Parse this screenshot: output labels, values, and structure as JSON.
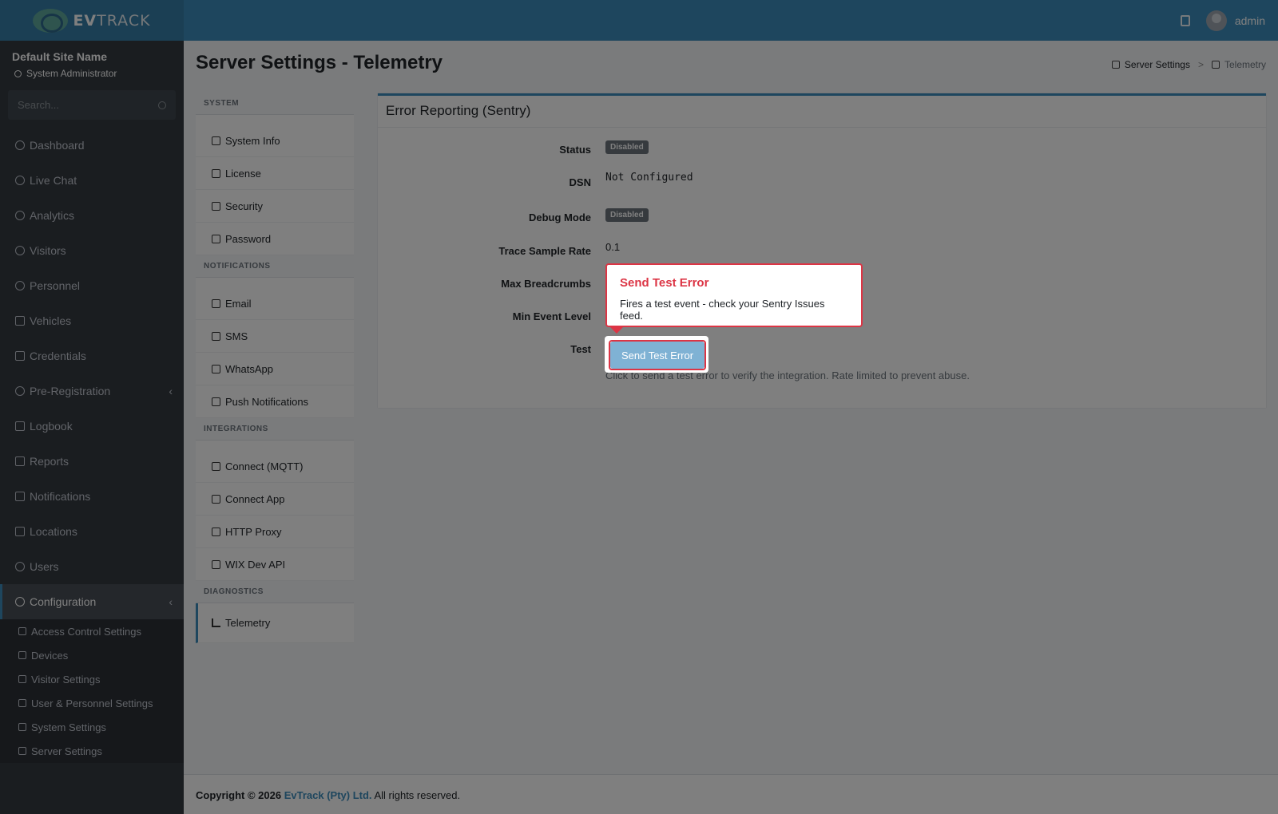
{
  "brand": {
    "name_bold": "EV",
    "name_light": "TRACK"
  },
  "topbar": {
    "user": "admin"
  },
  "sidebar": {
    "site_name": "Default Site Name",
    "role": "System Administrator",
    "search_placeholder": "Search...",
    "items": [
      {
        "label": "Dashboard",
        "icon": "gauge-icon"
      },
      {
        "label": "Live Chat",
        "icon": "headset-icon"
      },
      {
        "label": "Analytics",
        "icon": "target-icon"
      },
      {
        "label": "Visitors",
        "icon": "eye-icon"
      },
      {
        "label": "Personnel",
        "icon": "user-gear-icon"
      },
      {
        "label": "Vehicles",
        "icon": "car-icon"
      },
      {
        "label": "Credentials",
        "icon": "id-card-icon"
      },
      {
        "label": "Pre-Registration",
        "icon": "arrows-icon"
      },
      {
        "label": "Logbook",
        "icon": "book-icon"
      },
      {
        "label": "Reports",
        "icon": "chart-area-icon"
      },
      {
        "label": "Notifications",
        "icon": "chat-icon"
      },
      {
        "label": "Locations",
        "icon": "map-icon"
      },
      {
        "label": "Users",
        "icon": "users-icon"
      },
      {
        "label": "Configuration",
        "icon": "gear-icon"
      }
    ],
    "config_sub": [
      {
        "label": "Access Control Settings"
      },
      {
        "label": "Devices"
      },
      {
        "label": "Visitor Settings"
      },
      {
        "label": "User & Personnel Settings"
      },
      {
        "label": "System Settings"
      },
      {
        "label": "Server Settings"
      }
    ]
  },
  "page": {
    "title": "Server Settings - Telemetry",
    "breadcrumb": [
      "Server Settings",
      "Telemetry"
    ]
  },
  "settings_menu": {
    "system_header": "SYSTEM",
    "system": [
      "System Info",
      "License",
      "Security",
      "Password"
    ],
    "notifications_header": "NOTIFICATIONS",
    "notifications": [
      "Email",
      "SMS",
      "WhatsApp",
      "Push Notifications"
    ],
    "integrations_header": "INTEGRATIONS",
    "integrations": [
      "Connect (MQTT)",
      "Connect App",
      "HTTP Proxy",
      "WIX Dev API"
    ],
    "diagnostics_header": "DIAGNOSTICS",
    "diagnostics": [
      "Telemetry"
    ]
  },
  "card": {
    "title": "Error Reporting (Sentry)",
    "rows": {
      "status_label": "Status",
      "status_value": "Disabled",
      "dsn_label": "DSN",
      "dsn_value": "Not Configured",
      "debug_label": "Debug Mode",
      "debug_value": "Disabled",
      "trace_label": "Trace Sample Rate",
      "trace_value": "0.1",
      "breadcrumbs_label": "Max Breadcrumbs",
      "min_level_label": "Min Event Level",
      "test_label": "Test"
    },
    "test_button": "Send Test Error",
    "help": "Click to send a test error to verify the integration. Rate limited to prevent abuse."
  },
  "tour_tip": {
    "title": "Send Test Error",
    "body": "Fires a test event - check your Sentry Issues feed."
  },
  "footer": {
    "prefix": "Copyright © 2026",
    "company": "EvTrack (Pty) Ltd.",
    "suffix": "All rights reserved."
  },
  "colors": {
    "primary": "#3c8dbc",
    "sidebar": "#343a40",
    "danger": "#dc3545"
  }
}
